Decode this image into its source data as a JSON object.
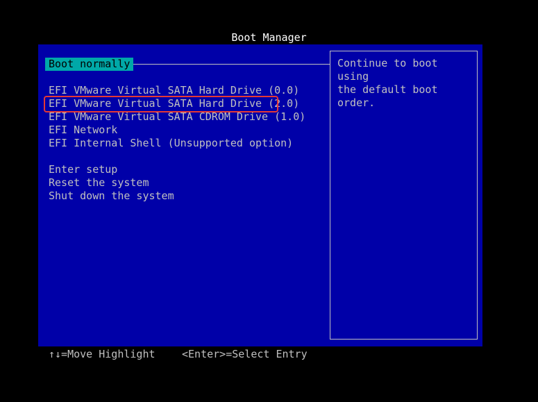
{
  "title": "Boot Manager",
  "selected_item": "Boot normally",
  "boot_entries": [
    "EFI VMware Virtual SATA Hard Drive (0.0)",
    "EFI VMware Virtual SATA Hard Drive (2.0)",
    "EFI VMware Virtual SATA CDROM Drive (1.0)",
    "EFI Network",
    "EFI Internal Shell (Unsupported option)"
  ],
  "system_entries": [
    "Enter setup",
    "Reset the system",
    "Shut down the system"
  ],
  "description": "Continue to boot using\nthe default boot order.",
  "footer": {
    "move_hint": "↑↓=Move Highlight",
    "select_hint": "<Enter>=Select Entry"
  },
  "colors": {
    "panel_bg": "#0000a8",
    "selection_bg": "#00a8a8",
    "annotation_box": "#e53935"
  }
}
